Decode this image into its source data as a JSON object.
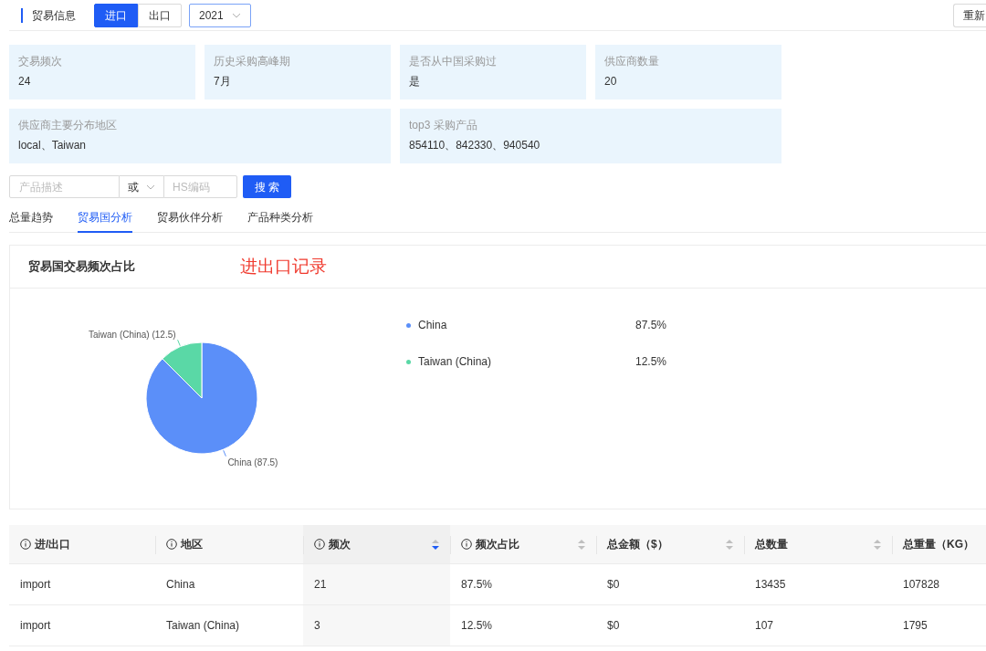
{
  "header": {
    "title": "贸易信息",
    "direction_tabs": [
      {
        "label": "进口",
        "selected": true
      },
      {
        "label": "出口",
        "selected": false
      }
    ],
    "year": "2021",
    "reset_button": "重新"
  },
  "stats": [
    {
      "label": "交易频次",
      "value": "24",
      "wide": false
    },
    {
      "label": "历史采购高峰期",
      "value": "7月",
      "wide": false
    },
    {
      "label": "是否从中国采购过",
      "value": "是",
      "wide": false
    },
    {
      "label": "供应商数量",
      "value": "20",
      "wide": false
    },
    {
      "label": "供应商主要分布地区",
      "value": "local、Taiwan",
      "wide": true
    },
    {
      "label": "top3 采购产品",
      "value": "854110、842330、940540",
      "wide": true
    }
  ],
  "search": {
    "product_placeholder": "产品描述",
    "operator": "或",
    "hs_placeholder": "HS编码",
    "button": "搜 索"
  },
  "tabs": [
    {
      "label": "总量趋势",
      "selected": false
    },
    {
      "label": "贸易国分析",
      "selected": true
    },
    {
      "label": "贸易伙伴分析",
      "selected": false
    },
    {
      "label": "产品种类分析",
      "selected": false
    }
  ],
  "chart_panel": {
    "title": "贸易国交易频次占比",
    "annotation": "进出口记录",
    "chart_data": {
      "type": "pie",
      "values": [
        87.5,
        12.5
      ],
      "value_labels": [
        "China (87.5)",
        "Taiwan (China) (12.5)"
      ]
    },
    "legend": [
      {
        "label": "China",
        "value": "87.5%",
        "color": "#5b8ff9"
      },
      {
        "label": "Taiwan (China)",
        "value": "12.5%",
        "color": "#5ad8a6"
      }
    ]
  },
  "table": {
    "columns": [
      {
        "label": "进/出口",
        "info": true,
        "sortable": false,
        "sorted_desc": false
      },
      {
        "label": "地区",
        "info": true,
        "sortable": false,
        "sorted_desc": false
      },
      {
        "label": "频次",
        "info": true,
        "sortable": true,
        "sorted_desc": true
      },
      {
        "label": "频次占比",
        "info": true,
        "sortable": true,
        "sorted_desc": false
      },
      {
        "label": "总金额（$）",
        "info": false,
        "sortable": true,
        "sorted_desc": false
      },
      {
        "label": "总数量",
        "info": false,
        "sortable": true,
        "sorted_desc": false
      },
      {
        "label": "总重量（KG）",
        "info": false
      }
    ],
    "rows": [
      [
        "import",
        "China",
        "21",
        "87.5%",
        "$0",
        "13435",
        "107828"
      ],
      [
        "import",
        "Taiwan (China)",
        "3",
        "12.5%",
        "$0",
        "107",
        "1795"
      ]
    ]
  }
}
